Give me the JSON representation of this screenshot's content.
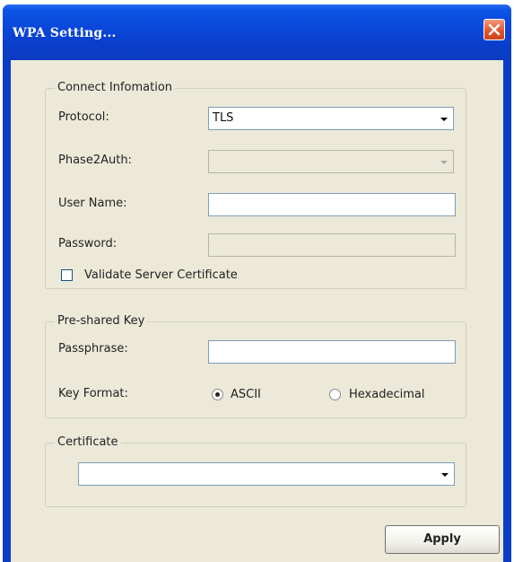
{
  "window": {
    "title": "WPA Setting...",
    "title_bar_color": "#0a46d8",
    "close_color": "#e2552c"
  },
  "connect_info": {
    "group_label": "Connect Infomation",
    "protocol_label": "Protocol:",
    "protocol_value": "TLS",
    "phase2auth_label": "Phase2Auth:",
    "phase2auth_value": "",
    "username_label": "User Name:",
    "username_value": "",
    "password_label": "Password:",
    "password_value": "",
    "validate_label": "Validate Server Certificate",
    "validate_checked": false
  },
  "psk": {
    "group_label": "Pre-shared Key",
    "passphrase_label": "Passphrase:",
    "passphrase_value": "",
    "key_format_label": "Key Format:",
    "ascii_label": "ASCII",
    "ascii_selected": true,
    "hex_label": "Hexadecimal",
    "hex_selected": false
  },
  "certificate": {
    "group_label": "Certificate",
    "selected_value": ""
  },
  "apply_label": "Apply"
}
